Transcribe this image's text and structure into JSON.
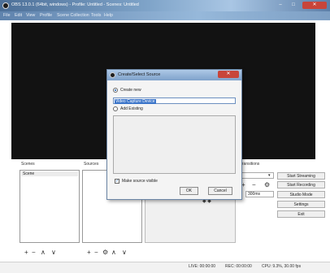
{
  "window": {
    "title": "OBS 13.0.1 (64bit, windows) - Profile: Untitled - Scenes: Untitled",
    "minimize_glyph": "–",
    "maximize_glyph": "□",
    "close_glyph": "✕"
  },
  "menu": [
    "File",
    "Edit",
    "View",
    "Profile",
    "Scene Collection",
    "Tools",
    "Help"
  ],
  "panels": {
    "scenes_label": "Scenes",
    "sources_label": "Sources",
    "transitions_label": "Transitions",
    "scene_items": [
      "Scene"
    ],
    "duration_value": "300ms"
  },
  "controls": [
    "Start Streaming",
    "Start Recording",
    "Studio Mode",
    "Settings",
    "Exit"
  ],
  "status": {
    "live": "LIVE: 00:00:00",
    "rec": "REC: 00:00:00",
    "cpu": "CPU: 9.3%, 30.00 fps"
  },
  "dialog": {
    "title": "Create/Select Source",
    "create_new_label": "Create new",
    "name_value": "Video Capture Device",
    "add_existing_label": "Add Existing",
    "make_visible_label": "Make source visible",
    "ok_label": "OK",
    "cancel_label": "Cancel"
  },
  "icons": [
    "obs-logo-icon",
    "plus-icon",
    "minus-icon",
    "chevron-up-icon",
    "chevron-down-icon",
    "gear-icon"
  ],
  "colors": {
    "preview_bg": "#121212",
    "selection": "#3a74c9",
    "close_red": "#c8453a"
  }
}
